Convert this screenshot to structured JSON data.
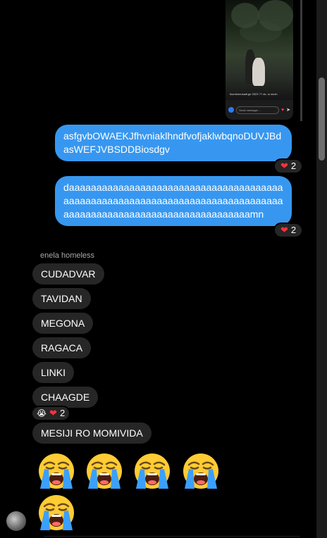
{
  "shared_post": {
    "caption": "ikorobonusadi.ge 2023 ?? ok, ru sicoh",
    "message_placeholder": "Send message..."
  },
  "outgoing": [
    {
      "text": "asfgvbOWAEKJfhvniaklhndfvofjaklwbqnoDUVJBdasWEFJVBSDDBiosdgv",
      "reaction_count": "2"
    },
    {
      "text": "daaaaaaaaaaaaaaaaaaaaaaaaaaaaaaaaaaaaaaaaaaaaaaaaaaaaaaaaaaaaaaaaaaaaaaaaaaaaaaaaaaaaaaaaaaaaaaaaaaaaaaaaaaaaaaaaamn",
      "reaction_count": "2"
    }
  ],
  "incoming": {
    "sender_name": "enela homeless",
    "messages": [
      "CUDADVAR",
      "TAVIDAN",
      "MEGONA",
      "RAGACA",
      "LINKI",
      "CHAAGDE"
    ],
    "reactions": {
      "emoji": "😭",
      "heart": "❤",
      "count": "2"
    },
    "message_after": "MESIJI RO MOMIVIDA",
    "crying_emoji_count": 5
  },
  "icons": {
    "heart": "heart-icon",
    "crying": "loudly-crying-face-emoji",
    "send": "send-icon"
  },
  "colors": {
    "outgoing_bubble": "#3797f0",
    "incoming_bubble": "#262626",
    "heart": "#ff3040"
  }
}
